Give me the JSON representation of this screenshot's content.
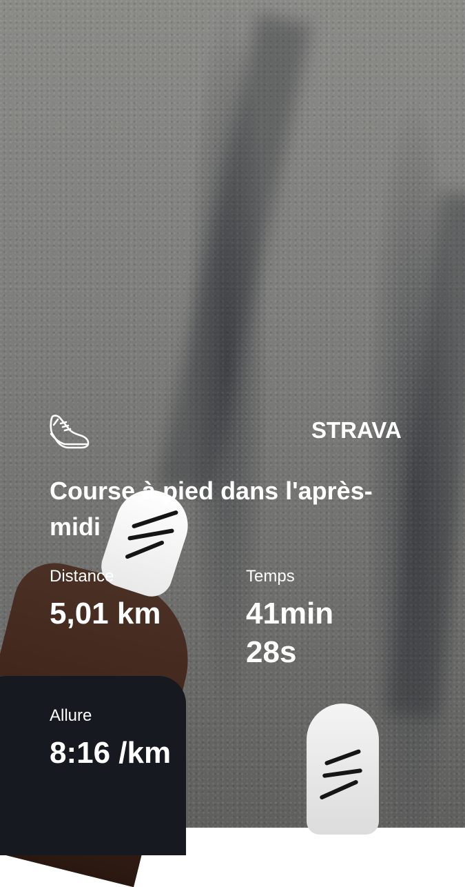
{
  "activity": {
    "title": "Course à pied dans l'après-midi",
    "brand": "STRAVA",
    "icon": "running-shoe-icon"
  },
  "stats": {
    "distance": {
      "label": "Distance",
      "value": "5,01 km"
    },
    "time": {
      "label": "Temps",
      "value_line1": "41min",
      "value_line2": "28s"
    },
    "pace": {
      "label": "Allure",
      "value": "8:16 /km"
    }
  },
  "colors": {
    "text": "#ffffff",
    "asphalt": "#7f7f7d"
  }
}
